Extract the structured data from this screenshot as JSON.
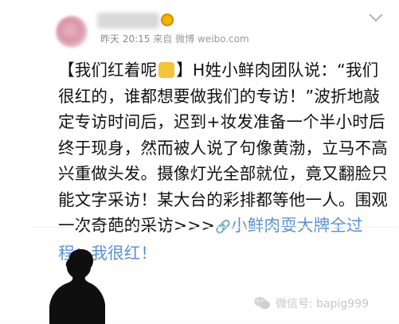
{
  "post": {
    "author_avatar_icon": "blurred-avatar",
    "author_name_redacted": true,
    "timestamp": "昨天 20:15",
    "source_prefix": "来自",
    "source_app": "微博",
    "source_site": "weibo.com",
    "body": {
      "tag": "【我们红着呢",
      "tag_end": "】",
      "main": "H姓小鲜肉团队说：“我们很红的，谁都想要做我们的专访！”波折地敲定专访时间后，迟到+妆发准备一个半小时后终于现身，然而被人说了句像黄渤，立马不高兴重做头发。摄像灯光全部就位，竟又翻脸只能文字采访！某大台的彩排都等他一人。围观一次奇葩的采访>>>",
      "link_icon": "link-icon",
      "link_text": "小鲜肉耍大牌全过程：我很红！"
    }
  },
  "watermark": {
    "icon": "wechat-icon",
    "text": "微信号: bapig999"
  },
  "colors": {
    "link": "#5b8fd3",
    "meta": "#8a8a8a",
    "text": "#111111"
  }
}
